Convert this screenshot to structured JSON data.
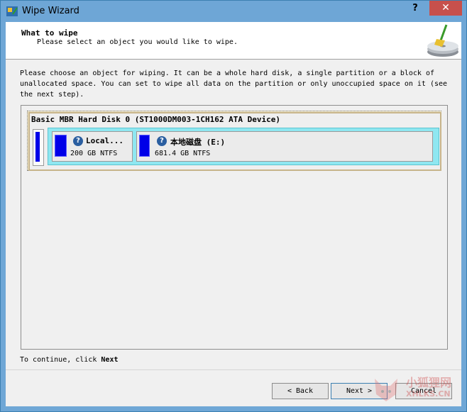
{
  "window": {
    "title": "Wipe Wizard",
    "help_label": "?",
    "close_label": "✕"
  },
  "header": {
    "title": "What to wipe",
    "subtitle": "Please select an object you would like to wipe."
  },
  "description": "Please choose an object for wiping. It can be a whole hard disk, a single partition or a block of unallocated space. You can set to wipe all data on the partition or only unoccupied space on it (see the next step).",
  "disk": {
    "label": "Basic MBR Hard Disk 0 (ST1000DM003-1CH162 ATA Device)",
    "partitions": [
      {
        "name": "Local...",
        "size": "200 GB NTFS"
      },
      {
        "name": "本地磁盘 (E:)",
        "size": "681.4 GB NTFS"
      }
    ]
  },
  "footer": {
    "continue_prefix": "To continue, click",
    "continue_bold": "Next"
  },
  "buttons": {
    "back": "< Back",
    "next": "Next >",
    "cancel": "Cancel"
  },
  "watermark": {
    "text": "小狐狸网",
    "sub": "XHLKS.CN"
  },
  "colors": {
    "titlebar": "#6ea6d6",
    "close": "#c7504c",
    "partition_fill": "#0000e8",
    "strip": "#8fe7f1"
  }
}
